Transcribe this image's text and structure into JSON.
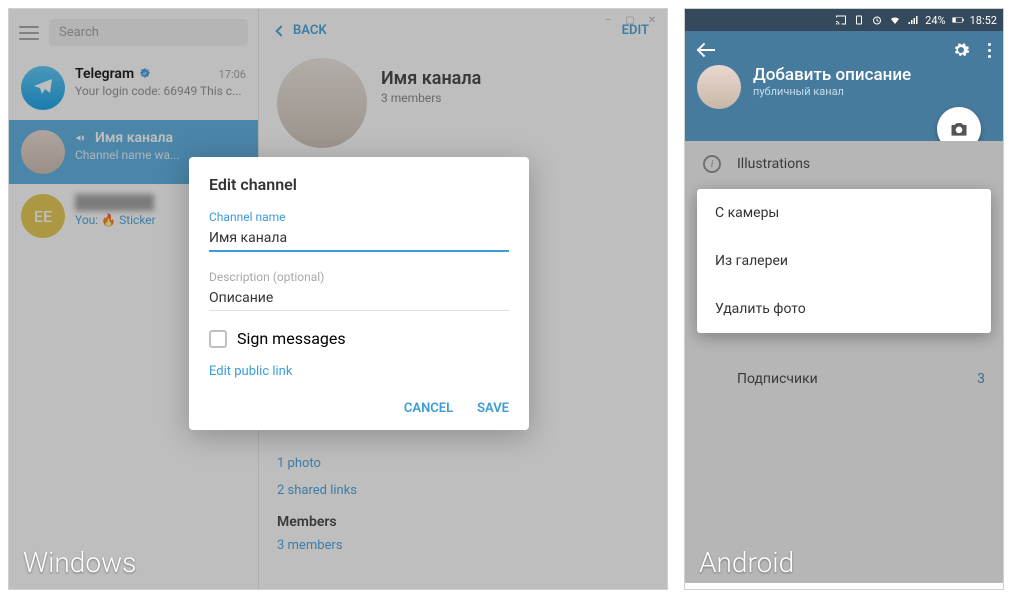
{
  "os_labels": {
    "left": "Windows",
    "right": "Android"
  },
  "windows": {
    "search_placeholder": "Search",
    "chats": [
      {
        "name": "Telegram",
        "time": "17:06",
        "preview": "Your login code: 66949  This c..."
      },
      {
        "name": "Имя канала",
        "preview": "Channel name wa..."
      },
      {
        "name": "EE",
        "preview": "You: 🔥 Sticker",
        "initials": "EE"
      }
    ],
    "main": {
      "back": "BACK",
      "edit": "EDIT",
      "channel_name": "Имя канала",
      "members": "3 members",
      "photo": "1 photo",
      "shared_links": "2 shared links",
      "members_heading": "Members",
      "members_count": "3 members"
    },
    "modal": {
      "title": "Edit channel",
      "channel_name_label": "Channel name",
      "channel_name_value": "Имя канала",
      "description_label": "Description (optional)",
      "description_value": "Описание",
      "sign_messages": "Sign messages",
      "edit_public_link": "Edit public link",
      "cancel": "CANCEL",
      "save": "SAVE"
    }
  },
  "android": {
    "status": {
      "battery": "24%",
      "time": "18:52"
    },
    "header": {
      "title": "Добавить описание",
      "subtitle": "публичный канал"
    },
    "illustrations": "Illustrations",
    "subscribers_label": "Подписчики",
    "subscribers_count": "3",
    "menu": {
      "camera": "С камеры",
      "gallery": "Из галереи",
      "delete": "Удалить фото"
    }
  }
}
